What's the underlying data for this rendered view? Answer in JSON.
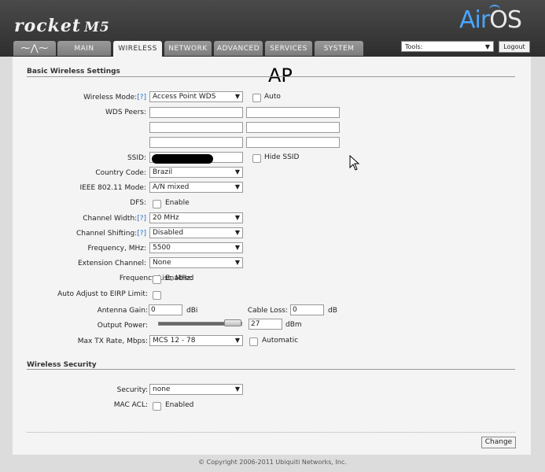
{
  "header": {
    "logo": "rocket",
    "model": "M5",
    "airos_air": "Air",
    "airos_os": "OS"
  },
  "tabs": [
    {
      "label": "",
      "icon": "ubiquiti-logo-icon"
    },
    {
      "label": "MAIN"
    },
    {
      "label": "WIRELESS",
      "active": true
    },
    {
      "label": "NETWORK"
    },
    {
      "label": "ADVANCED"
    },
    {
      "label": "SERVICES"
    },
    {
      "label": "SYSTEM"
    }
  ],
  "tools": {
    "label": "Tools:",
    "arrow": "▼"
  },
  "logout_label": "Logout",
  "overlay_text": "AP",
  "basic": {
    "title": "Basic Wireless Settings",
    "wireless_mode": {
      "label": "Wireless Mode:",
      "help": "[?]",
      "value": "Access Point WDS",
      "auto": "Auto"
    },
    "wds_peers": {
      "label": "WDS Peers:"
    },
    "ssid": {
      "label": "SSID:",
      "hide": "Hide SSID"
    },
    "country_code": {
      "label": "Country Code:",
      "value": "Brazil"
    },
    "ieee_mode": {
      "label": "IEEE 802.11 Mode:",
      "value": "A/N mixed"
    },
    "dfs": {
      "label": "DFS:",
      "option": "Enable"
    },
    "channel_width": {
      "label": "Channel Width:",
      "help": "[?]",
      "value": "20 MHz"
    },
    "channel_shifting": {
      "label": "Channel Shifting:",
      "help": "[?]",
      "value": "Disabled"
    },
    "frequency": {
      "label": "Frequency, MHz:",
      "value": "5500"
    },
    "extension_channel": {
      "label": "Extension Channel:",
      "value": "None"
    },
    "frequency_list": {
      "label": "Frequency List, MHz:",
      "option": "Enabled"
    },
    "auto_eirp": {
      "label": "Auto Adjust to EIRP Limit:"
    },
    "antenna_gain": {
      "label": "Antenna Gain:",
      "value": "0",
      "unit": "dBi"
    },
    "cable_loss": {
      "label": "Cable Loss:",
      "value": "0",
      "unit": "dB"
    },
    "output_power": {
      "label": "Output Power:",
      "value": "27",
      "unit": "dBm",
      "level": 1.0
    },
    "max_tx": {
      "label": "Max TX Rate, Mbps:",
      "value": "MCS 12 - 78",
      "auto": "Automatic"
    }
  },
  "security": {
    "title": "Wireless Security",
    "security": {
      "label": "Security:",
      "value": "none"
    },
    "mac_acl": {
      "label": "MAC ACL:",
      "option": "Enabled"
    }
  },
  "change_label": "Change",
  "footer": "© Copyright 2006-2011 Ubiquiti Networks, Inc."
}
